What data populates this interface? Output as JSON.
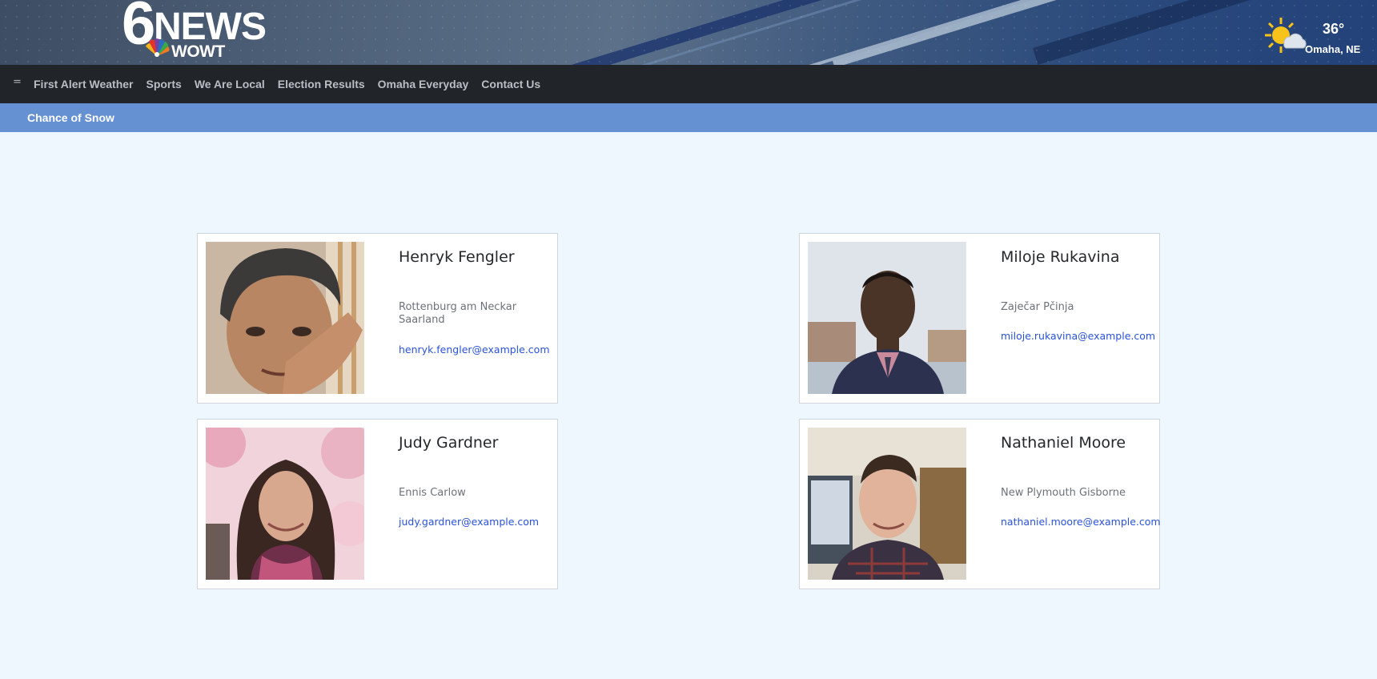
{
  "header": {
    "logo": {
      "six": "6",
      "news": "NEWS",
      "call_sign": "WOWT"
    },
    "weather": {
      "temperature": "36°",
      "location": "Omaha, NE",
      "icon": "partly-sunny-icon"
    }
  },
  "nav": {
    "menu_icon": "=",
    "items": [
      {
        "label": "First Alert Weather"
      },
      {
        "label": "Sports"
      },
      {
        "label": "We Are Local"
      },
      {
        "label": "Election Results"
      },
      {
        "label": "Omaha Everyday"
      },
      {
        "label": "Contact Us"
      }
    ]
  },
  "alert": {
    "text": "Chance of Snow"
  },
  "people": [
    {
      "name": "Henryk Fengler",
      "place": "Rottenburg am Neckar Saarland",
      "email": "henryk.fengler@example.com"
    },
    {
      "name": "Miloje Rukavina",
      "place": "Zaječar Pčinja",
      "email": "miloje.rukavina@example.com"
    },
    {
      "name": "Judy Gardner",
      "place": "Ennis Carlow",
      "email": "judy.gardner@example.com"
    },
    {
      "name": "Nathaniel Moore",
      "place": "New Plymouth Gisborne",
      "email": "nathaniel.moore@example.com"
    }
  ],
  "colors": {
    "page_bg": "#eef6fe",
    "nav_bg": "#212529",
    "alert_bg": "#6590d2",
    "link": "#2a52d8"
  }
}
